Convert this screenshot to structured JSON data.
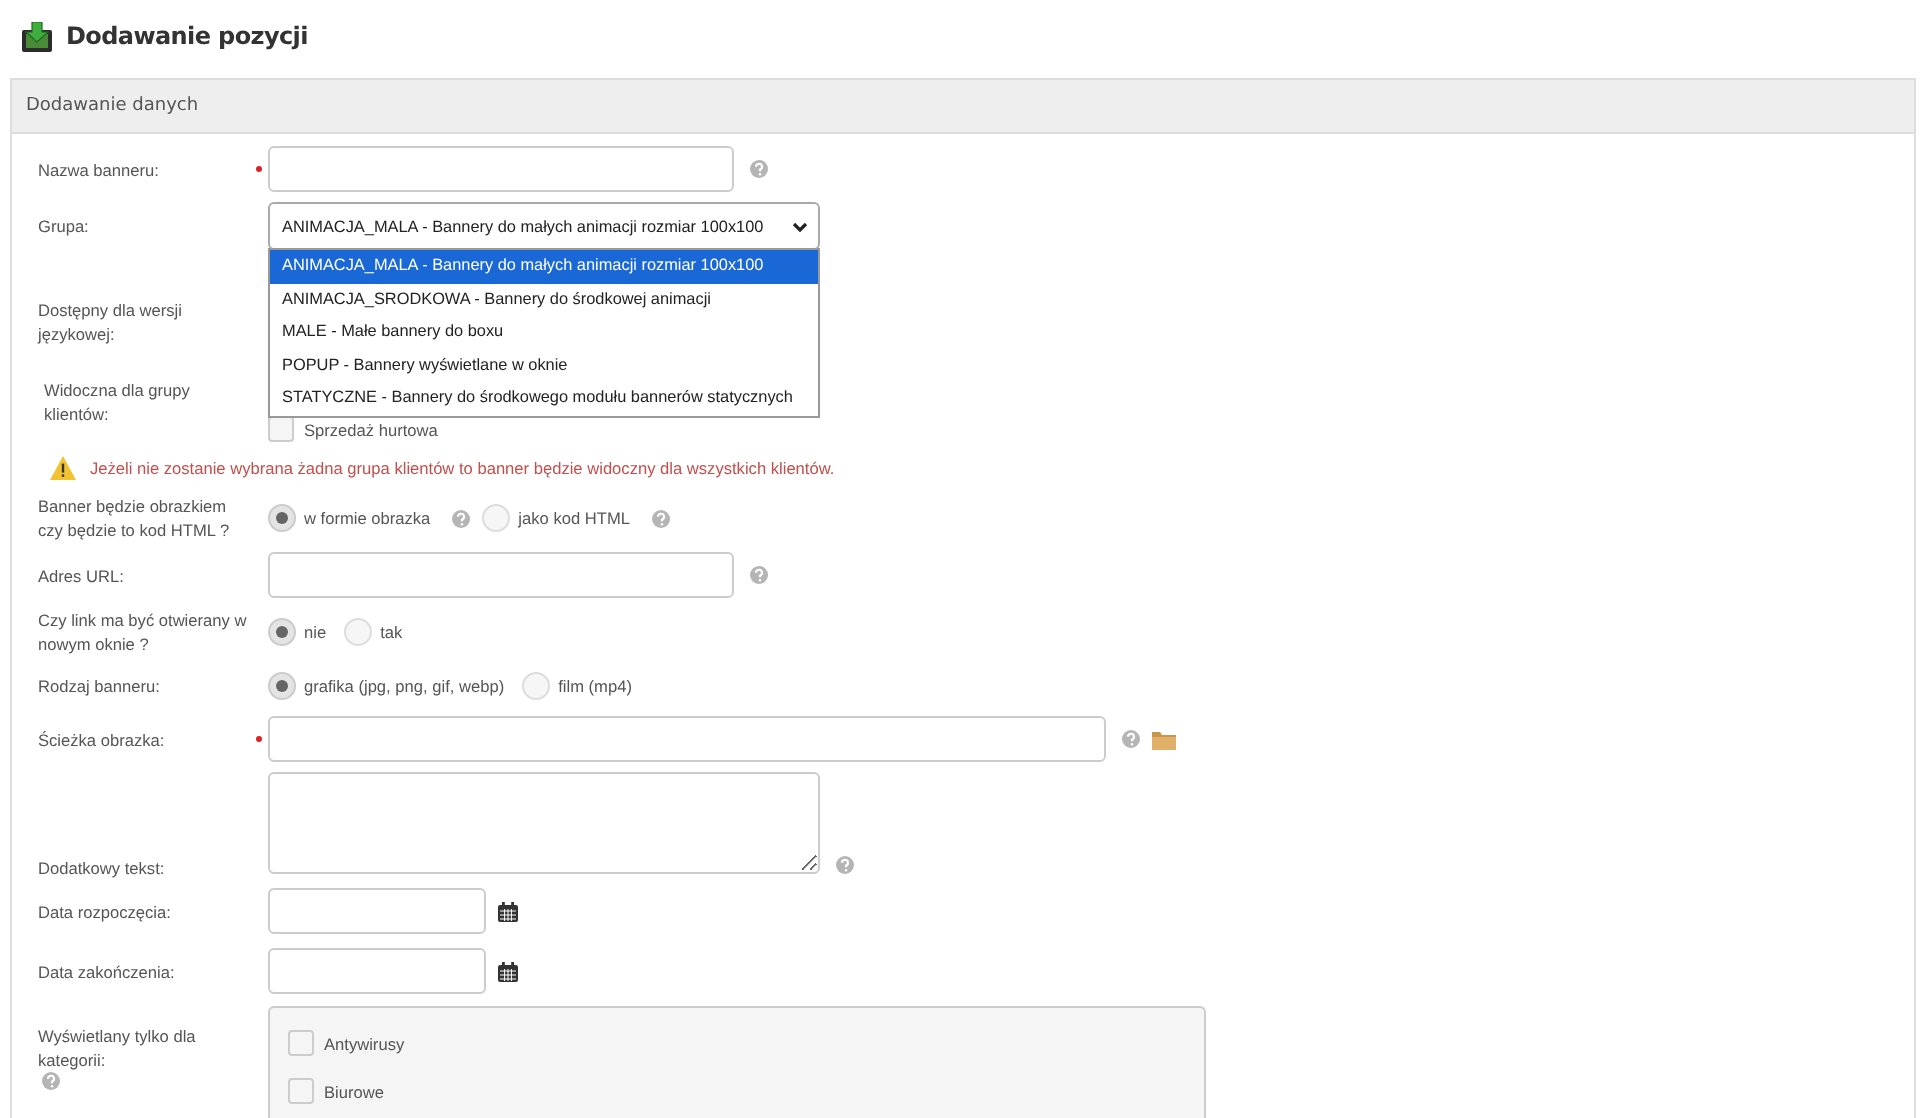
{
  "page_title": "Dodawanie pozycji",
  "panel": {
    "title": "Dodawanie danych",
    "rows": [
      {
        "kind": "text",
        "label": "Nazwa banneru:",
        "required": true,
        "help": true
      },
      {
        "kind": "select",
        "label": "Grupa:",
        "value": "ANIMACJA_MALA - Bannery do małych animacji rozmiar 100x100",
        "expanded": true,
        "options": [
          {
            "label": "ANIMACJA_MALA - Bannery do małych animacji rozmiar 100x100",
            "selected": true
          },
          {
            "label": "ANIMACJA_SRODKOWA - Bannery do środkowej animacji",
            "selected": false
          },
          {
            "label": "MALE - Małe bannery do boxu",
            "selected": false
          },
          {
            "label": "POPUP - Bannery wyświetlane w oknie",
            "selected": false
          },
          {
            "label": "STATYCZNE - Bannery do środkowego modułu bannerów statycznych",
            "selected": false
          }
        ]
      },
      {
        "kind": "label_only",
        "label": "Dostępny dla wersji językowej:"
      },
      {
        "kind": "checkboxes",
        "label": "Widoczna dla grupy klientów:",
        "options": [
          {
            "label": "Sprzedaż hurtowa",
            "checked": false
          }
        ]
      },
      {
        "kind": "warning",
        "text": "Jeżeli nie zostanie wybrana żadna grupa klientów to banner będzie widoczny dla wszystkich klientów."
      },
      {
        "kind": "radio",
        "label": "Banner będzie obrazkiem czy będzie to kod HTML ?",
        "options": [
          {
            "label": "w formie obrazka",
            "selected": true,
            "help": true
          },
          {
            "label": "jako kod HTML",
            "selected": false,
            "help": true
          }
        ]
      },
      {
        "kind": "text",
        "label": "Adres URL:",
        "help": true
      },
      {
        "kind": "radio",
        "label": "Czy link ma być otwierany w nowym oknie ?",
        "options": [
          {
            "label": "nie",
            "selected": true
          },
          {
            "label": "tak",
            "selected": false
          }
        ]
      },
      {
        "kind": "radio",
        "label": "Rodzaj banneru:",
        "options": [
          {
            "label": "grafika (jpg, png, gif, webp)",
            "selected": true
          },
          {
            "label": "film (mp4)",
            "selected": false
          }
        ]
      },
      {
        "kind": "text",
        "label": "Ścieżka obrazka:",
        "required": true,
        "help": true,
        "browse": true
      },
      {
        "kind": "textarea",
        "label": "Dodatkowy tekst:",
        "help": true
      },
      {
        "kind": "date",
        "label": "Data rozpoczęcia:"
      },
      {
        "kind": "date",
        "label": "Data zakończenia:"
      },
      {
        "kind": "category",
        "label": "Wyświetlany tylko dla kategorii:",
        "help": true,
        "options": [
          {
            "label": "Antywirusy",
            "checked": false
          },
          {
            "label": "Biurowe",
            "checked": false
          }
        ]
      }
    ]
  }
}
